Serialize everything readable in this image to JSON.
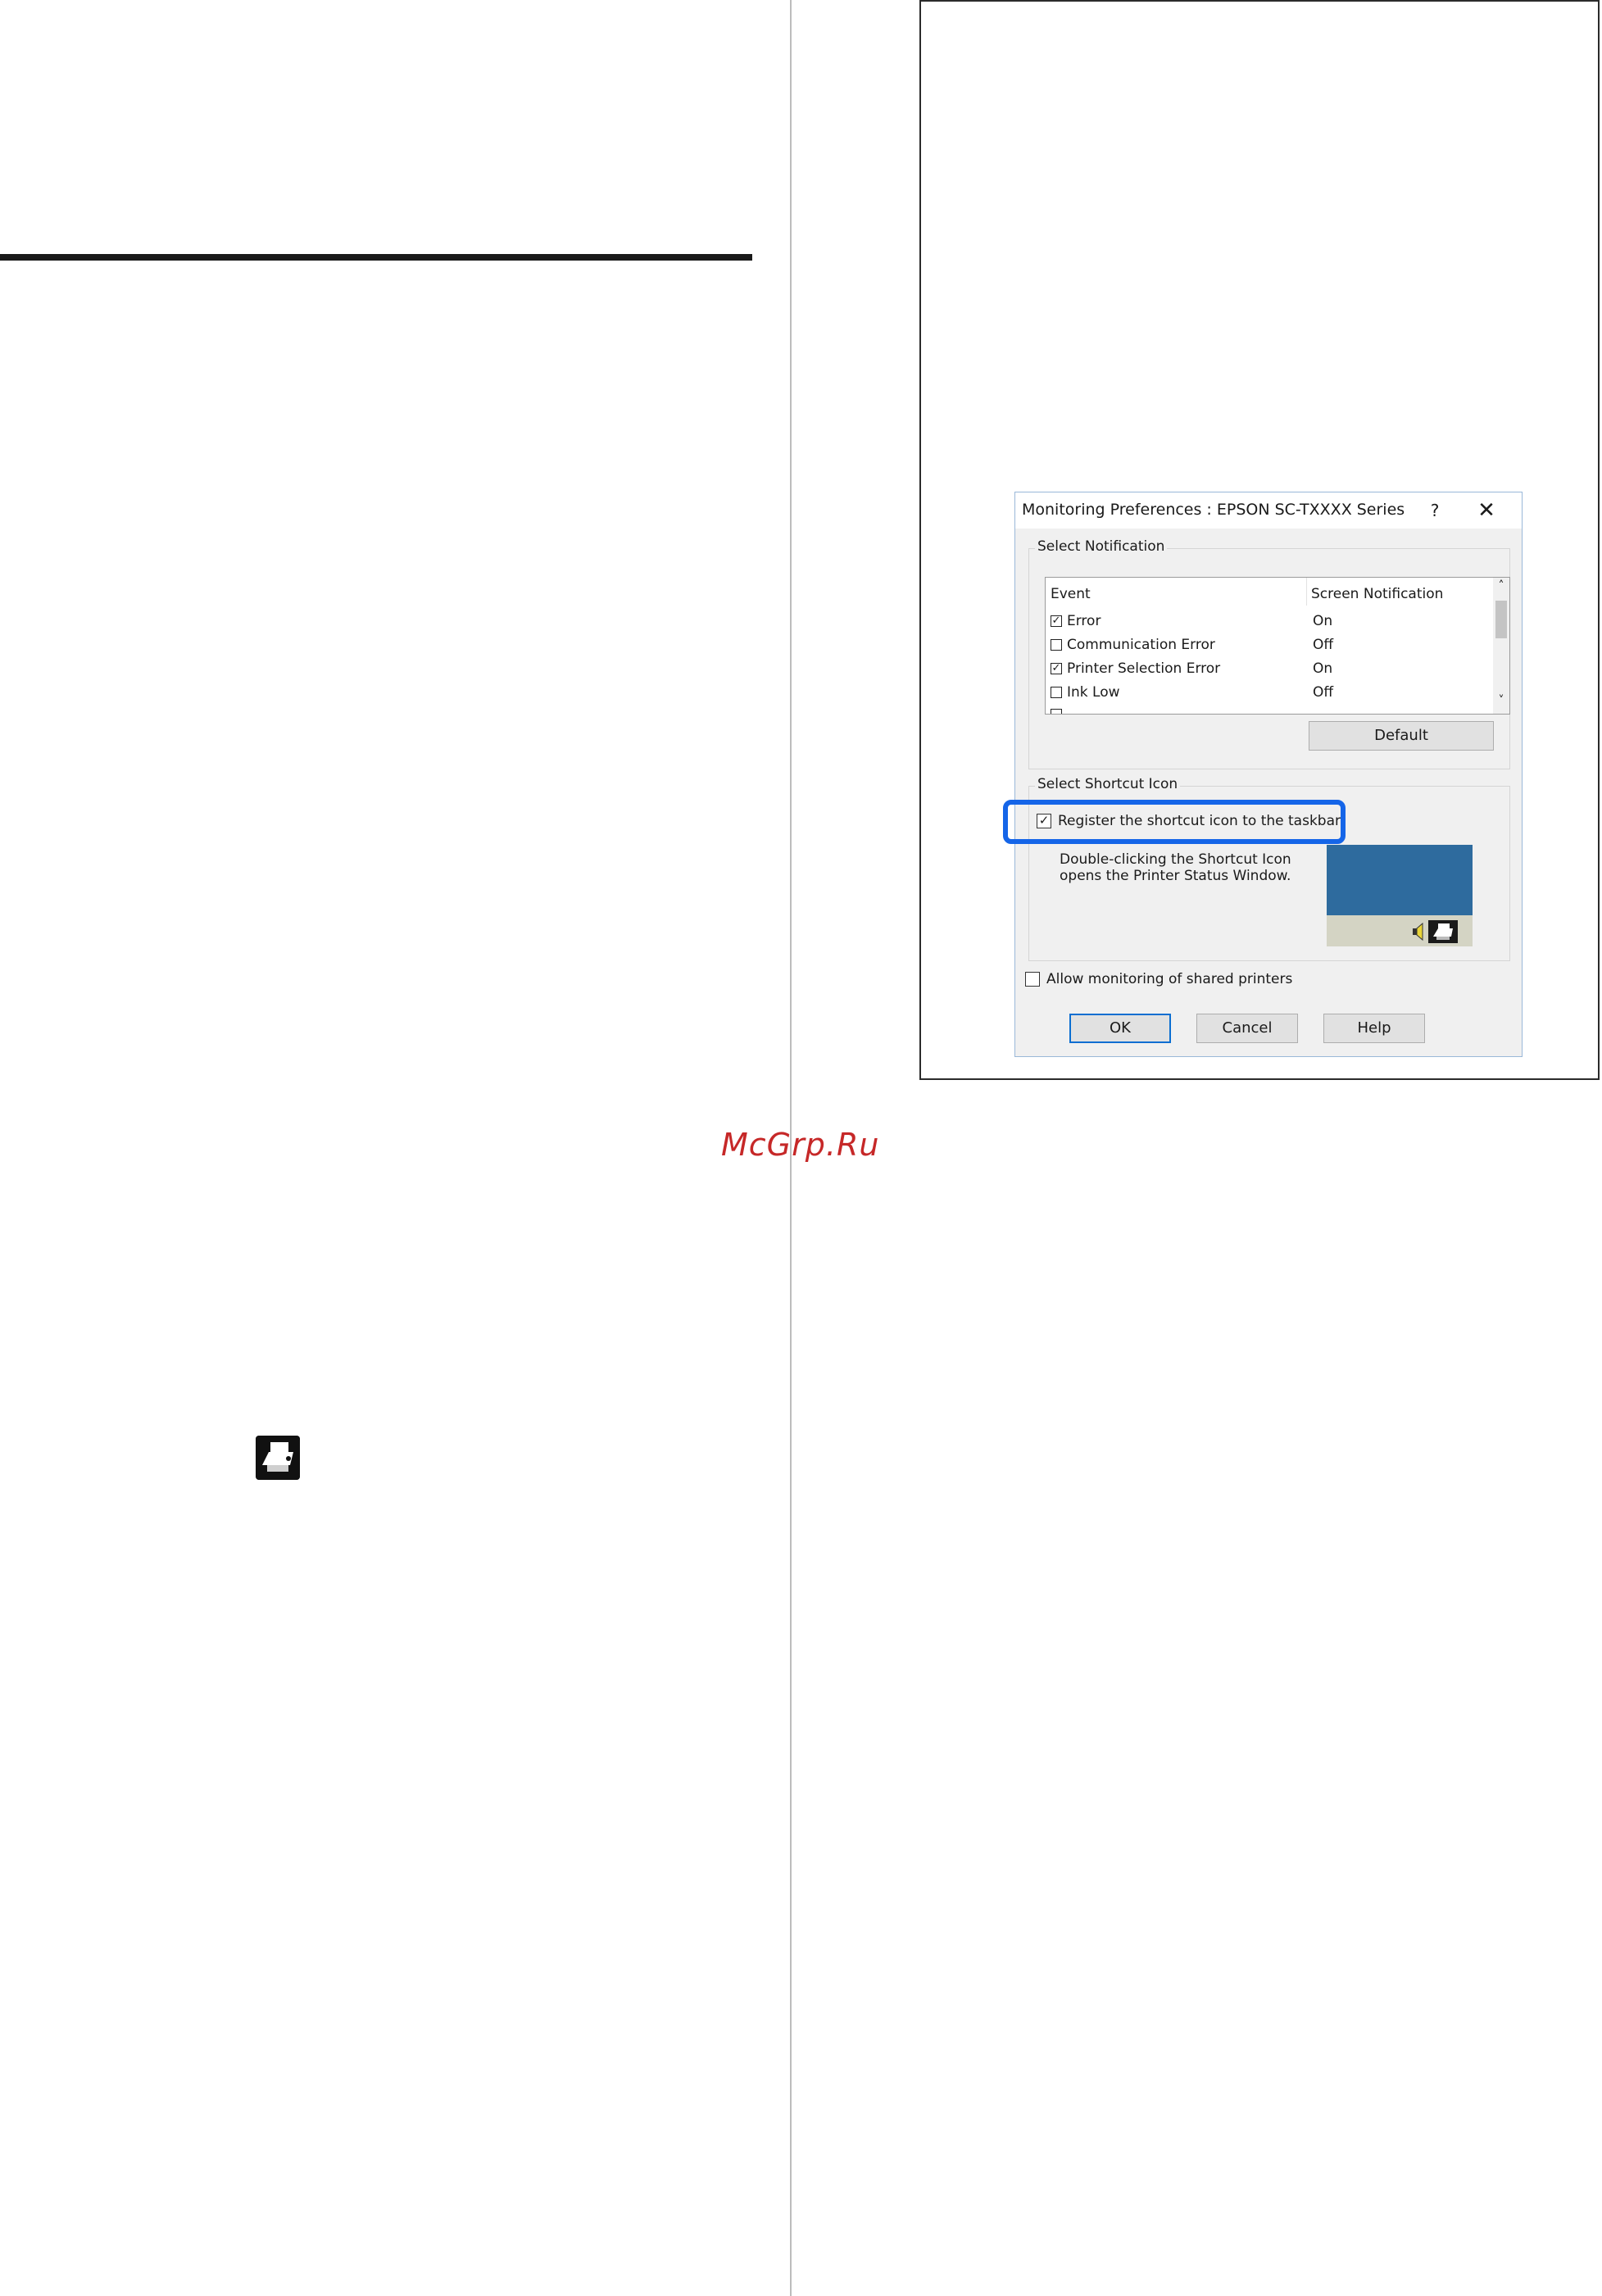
{
  "watermark": "McGrp.Ru",
  "dialog": {
    "title": "Monitoring Preferences : EPSON SC-TXXXX Series",
    "help_glyph": "?",
    "close_glyph": "✕",
    "select_notification": {
      "label": "Select Notification",
      "columns": [
        "Event",
        "Screen Notification"
      ],
      "rows": [
        {
          "event": "Error",
          "checked": true,
          "value": "On"
        },
        {
          "event": "Communication Error",
          "checked": false,
          "value": "Off"
        },
        {
          "event": "Printer Selection Error",
          "checked": true,
          "value": "On"
        },
        {
          "event": "Ink Low",
          "checked": false,
          "value": "Off"
        }
      ],
      "default_button": "Default"
    },
    "select_shortcut_icon": {
      "label": "Select Shortcut Icon",
      "register_label": "Register the shortcut icon to the taskbar",
      "register_checked": true,
      "description_line1": "Double-clicking the Shortcut Icon",
      "description_line2": "opens the Printer Status Window."
    },
    "allow_shared": {
      "label": "Allow monitoring of shared printers",
      "checked": false
    },
    "buttons": {
      "ok": "OK",
      "cancel": "Cancel",
      "help": "Help"
    }
  },
  "colors": {
    "highlight": "#1565e8",
    "preview_desktop": "#2e6b9e",
    "watermark": "#c62828"
  },
  "icons": [
    "printer-status-icon",
    "speaker-icon",
    "checkbox-checked",
    "checkbox-unchecked",
    "scroll-up-arrow",
    "scroll-down-arrow",
    "close-icon",
    "help-icon"
  ]
}
